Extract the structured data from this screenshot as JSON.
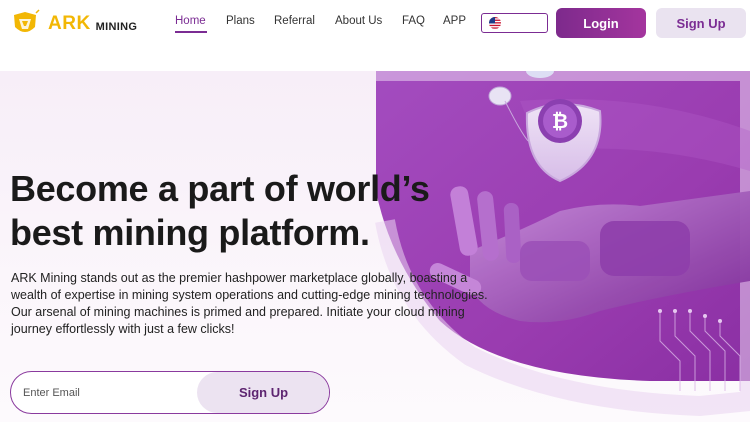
{
  "brand": {
    "name": "ARK",
    "sub": "MINING"
  },
  "nav": {
    "items": [
      {
        "label": "Home"
      },
      {
        "label": "Plans"
      },
      {
        "label": "Referral"
      },
      {
        "label": "About Us"
      },
      {
        "label": "FAQ"
      },
      {
        "label": "APP"
      }
    ],
    "active": "Home",
    "language_icon": "us-flag-icon"
  },
  "header": {
    "login_label": "Login",
    "signup_label": "Sign Up"
  },
  "hero": {
    "headline_line1": "Become a part of world’s",
    "headline_line2": "best mining platform.",
    "desc_line1": "ARK Mining stands out as the premier hashpower marketplace globally, boasting a",
    "desc_line2": "wealth of expertise in mining system operations and cutting-edge mining technologies.",
    "desc_line3": "Our arsenal of mining machines is primed and prepared. Initiate your cloud mining",
    "desc_line4": "journey effortlessly with just a few clicks!",
    "email_placeholder": "Enter Email",
    "email_button": "Sign Up",
    "illustration": "robot-hand-bitcoin-shield"
  },
  "colors": {
    "brand_purple": "#7b2c93",
    "logo_gold": "#f2b705",
    "hero_purple": "#9b3fb0"
  }
}
